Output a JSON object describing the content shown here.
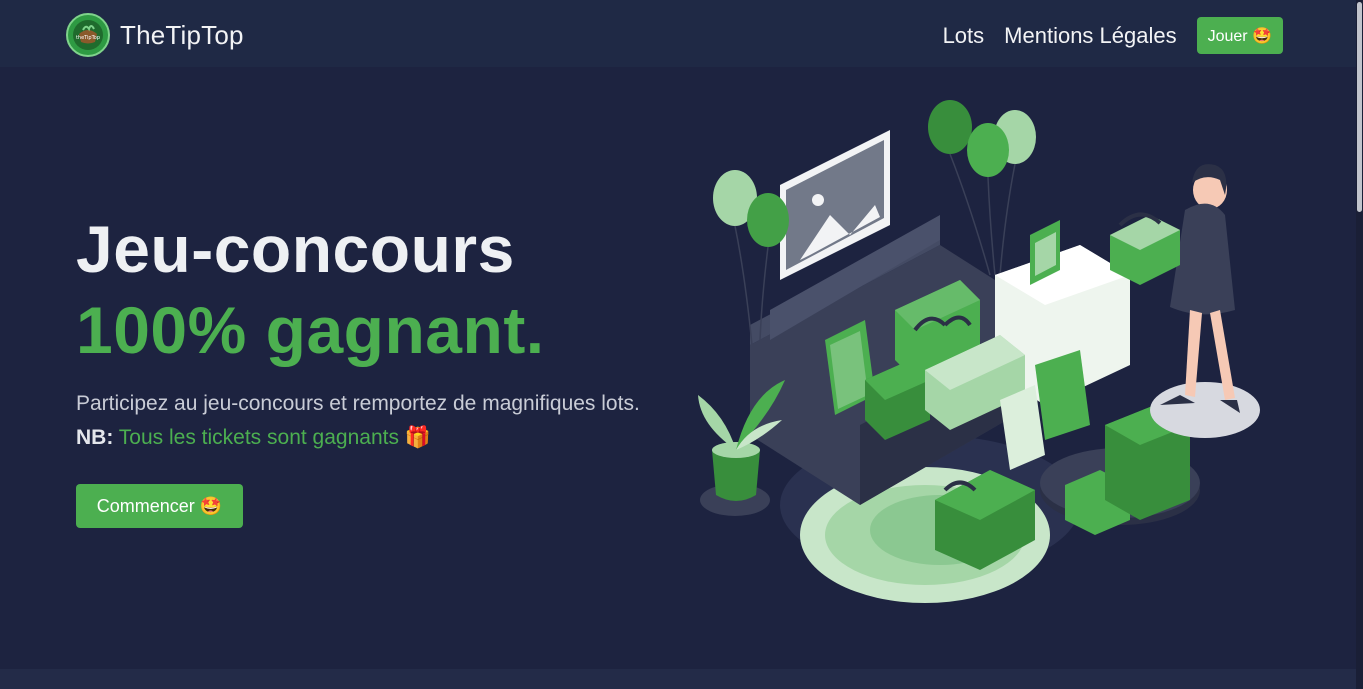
{
  "nav": {
    "brand": "TheTipTop",
    "logo_text": "theTipTop",
    "links": [
      "Lots",
      "Mentions Légales"
    ],
    "play_button": "Jouer 🤩"
  },
  "hero": {
    "title_line1": "Jeu-concours",
    "title_line2": "100% gagnant.",
    "lead_text": "Participez au jeu-concours et remportez de magnifiques lots.",
    "nb_label": "NB:",
    "highlight": "Tous les tickets sont gagnants",
    "gift_emoji": "🎁",
    "cta": "Commencer 🤩"
  },
  "colors": {
    "accent": "#4caf50",
    "navbar_bg": "#1f2945",
    "page_bg": "#1d2340"
  },
  "icons": [
    "brand-logo-icon",
    "gift-emoji",
    "gifts-illustration"
  ]
}
